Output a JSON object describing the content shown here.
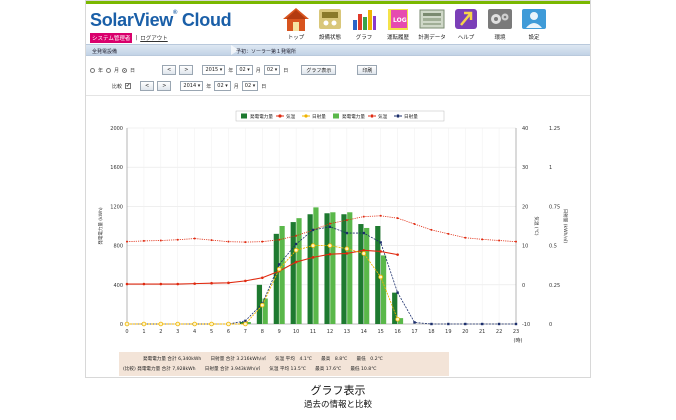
{
  "app": {
    "logo": "SolarView",
    "logo_mark": "®",
    "logo_word": "Cloud",
    "admin_link": "システム管理者",
    "logout_link": "ログアウト"
  },
  "nav": [
    {
      "label": "トップ",
      "icon": "house-icon"
    },
    {
      "label": "設備状態",
      "icon": "device-icon"
    },
    {
      "label": "グラフ",
      "icon": "bar-chart-icon"
    },
    {
      "label": "運転履歴",
      "icon": "log-icon"
    },
    {
      "label": "計測データ",
      "icon": "data-icon"
    },
    {
      "label": "ヘルプ",
      "icon": "help-icon"
    },
    {
      "label": "環境",
      "icon": "gear-icon"
    },
    {
      "label": "設定",
      "icon": "user-icon"
    }
  ],
  "subhead": {
    "left": "全発電設備",
    "right": "予初：ソーラー第１発電所"
  },
  "controls": {
    "period_labels": [
      "年",
      "月",
      "日"
    ],
    "prev_btn": "<",
    "next_btn": ">",
    "year": "2015",
    "year_unit": "年",
    "month": "02",
    "month_unit": "月",
    "day": "02",
    "day_unit": "日",
    "show_graph": "グラフ表示",
    "print": "印刷",
    "compare_label": "比較",
    "compare_checked": "✔",
    "cmp_year": "2014",
    "cmp_month": "02",
    "cmp_day": "02"
  },
  "summary": {
    "row1": "発電電力量 合計 6,340kWh　　日射量 合計 3.216kWh/㎡　　気温 平均　4.1℃　　最高　8.8℃　　最低　0.2℃",
    "row2": "(比較) 発電電力量 合計 7,928kWh　　日射量 合計 3.943kWh/㎡　　気温 平均 13.5℃　　最高 17.6℃　　最低 10.8℃"
  },
  "caption": {
    "title": "グラフ表示",
    "subtitle": "過去の情報と比較"
  },
  "chart_data": {
    "type": "bar",
    "x": [
      0,
      1,
      2,
      3,
      4,
      5,
      6,
      7,
      8,
      9,
      10,
      11,
      12,
      13,
      14,
      15,
      16,
      17,
      18,
      19,
      20,
      21,
      22,
      23
    ],
    "xlabel_unit": "(時)",
    "ylabel_left": "発電電力量 (kWh)",
    "ylabel_mid": "気温 (℃)",
    "ylabel_right": "日射量 (kWh/㎡)",
    "y_left_ticks": [
      "0",
      "400",
      "800",
      "1200",
      "1600",
      "2000"
    ],
    "y_mid_ticks": [
      "-10",
      "0",
      "10",
      "20",
      "30",
      "40"
    ],
    "y_right_ticks": [
      "0",
      "0.25",
      "0.5",
      "0.75",
      "1",
      "1.25"
    ],
    "ylim_left": [
      0,
      2000
    ],
    "ylim_mid": [
      -10,
      40
    ],
    "ylim_right": [
      0,
      1.25
    ],
    "legend": [
      "発電電力量",
      "気温",
      "日射量",
      "発電電力量",
      "気温",
      "日射量"
    ],
    "grid": true,
    "series": [
      {
        "name": "発電電力量",
        "kind": "bar",
        "color": "#1e7a30",
        "values": [
          0,
          0,
          0,
          0,
          0,
          0,
          0,
          20,
          400,
          920,
          1040,
          1120,
          1130,
          1120,
          1020,
          1000,
          320,
          0,
          0,
          0,
          0,
          0,
          0,
          0
        ]
      },
      {
        "name": "気温",
        "kind": "line",
        "color": "#e02a10",
        "axis": "mid",
        "values": [
          0.2,
          0.2,
          0.2,
          0.2,
          0.3,
          0.4,
          0.5,
          1.0,
          1.8,
          3.5,
          5.8,
          7.0,
          7.8,
          8.0,
          8.8,
          8.5,
          7.7,
          null,
          null,
          null,
          null,
          null,
          null,
          null
        ]
      },
      {
        "name": "日射量",
        "kind": "line",
        "color": "#f0b400",
        "axis": "right",
        "values": [
          0,
          0,
          0,
          0,
          0,
          0,
          0,
          0,
          0.12,
          0.35,
          0.47,
          0.5,
          0.5,
          0.48,
          0.45,
          0.3,
          0.03,
          null,
          null,
          null,
          null,
          null,
          null,
          null
        ]
      },
      {
        "name": "発電電力量",
        "kind": "bar",
        "color": "#5ab84a",
        "values": [
          0,
          0,
          0,
          0,
          0,
          0,
          0,
          20,
          260,
          1000,
          1080,
          1190,
          1140,
          1140,
          980,
          700,
          60,
          0,
          0,
          0,
          0,
          0,
          0,
          0
        ]
      },
      {
        "name": "気温",
        "kind": "dotted",
        "color": "#e02a10",
        "axis": "mid",
        "values": [
          11.0,
          11.2,
          11.3,
          11.5,
          11.8,
          11.4,
          11.0,
          10.9,
          11.0,
          11.5,
          12.5,
          14.0,
          15.6,
          16.5,
          17.4,
          17.6,
          17.0,
          15.5,
          14.0,
          13.0,
          12.0,
          11.6,
          11.3,
          11.0
        ]
      },
      {
        "name": "日射量",
        "kind": "dashed",
        "color": "#1a2d6b",
        "axis": "right",
        "values": [
          0,
          0,
          0,
          0,
          0,
          0,
          0,
          0.02,
          0.13,
          0.38,
          0.51,
          0.6,
          0.62,
          0.58,
          0.58,
          0.52,
          0.2,
          0.01,
          0,
          0,
          0,
          0,
          0,
          0
        ]
      }
    ]
  }
}
